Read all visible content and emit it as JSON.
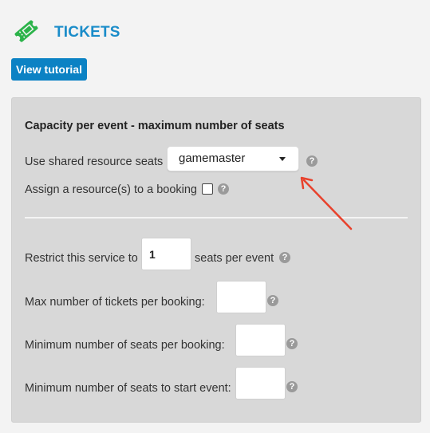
{
  "header": {
    "title": "TICKETS",
    "icon": "ticket-icon",
    "accent_color": "#1a8cc9",
    "icon_color": "#2cb34a"
  },
  "tutorial_button": {
    "label": "View tutorial",
    "color": "#0b82c4"
  },
  "panel": {
    "section_title": "Capacity per event - maximum number of seats",
    "shared_resource": {
      "label": "Use shared resource seats",
      "selected": "gamemaster",
      "help": "?"
    },
    "assign_resource": {
      "label": "Assign a resource(s) to a booking",
      "checked": false,
      "help": "?"
    },
    "restrict": {
      "prefix": "Restrict this service to",
      "value": "1",
      "suffix": "seats per event",
      "help": "?"
    },
    "max_tickets": {
      "label": "Max number of tickets per booking:",
      "value": "",
      "help": "?"
    },
    "min_seats_booking": {
      "label": "Minimum number of seats per booking:",
      "value": "",
      "help": "?"
    },
    "min_seats_start": {
      "label": "Minimum number of seats to start event:",
      "value": "",
      "help": "?"
    }
  },
  "annotation": {
    "icon": "red-arrow-annotation",
    "color": "#e8412c"
  }
}
